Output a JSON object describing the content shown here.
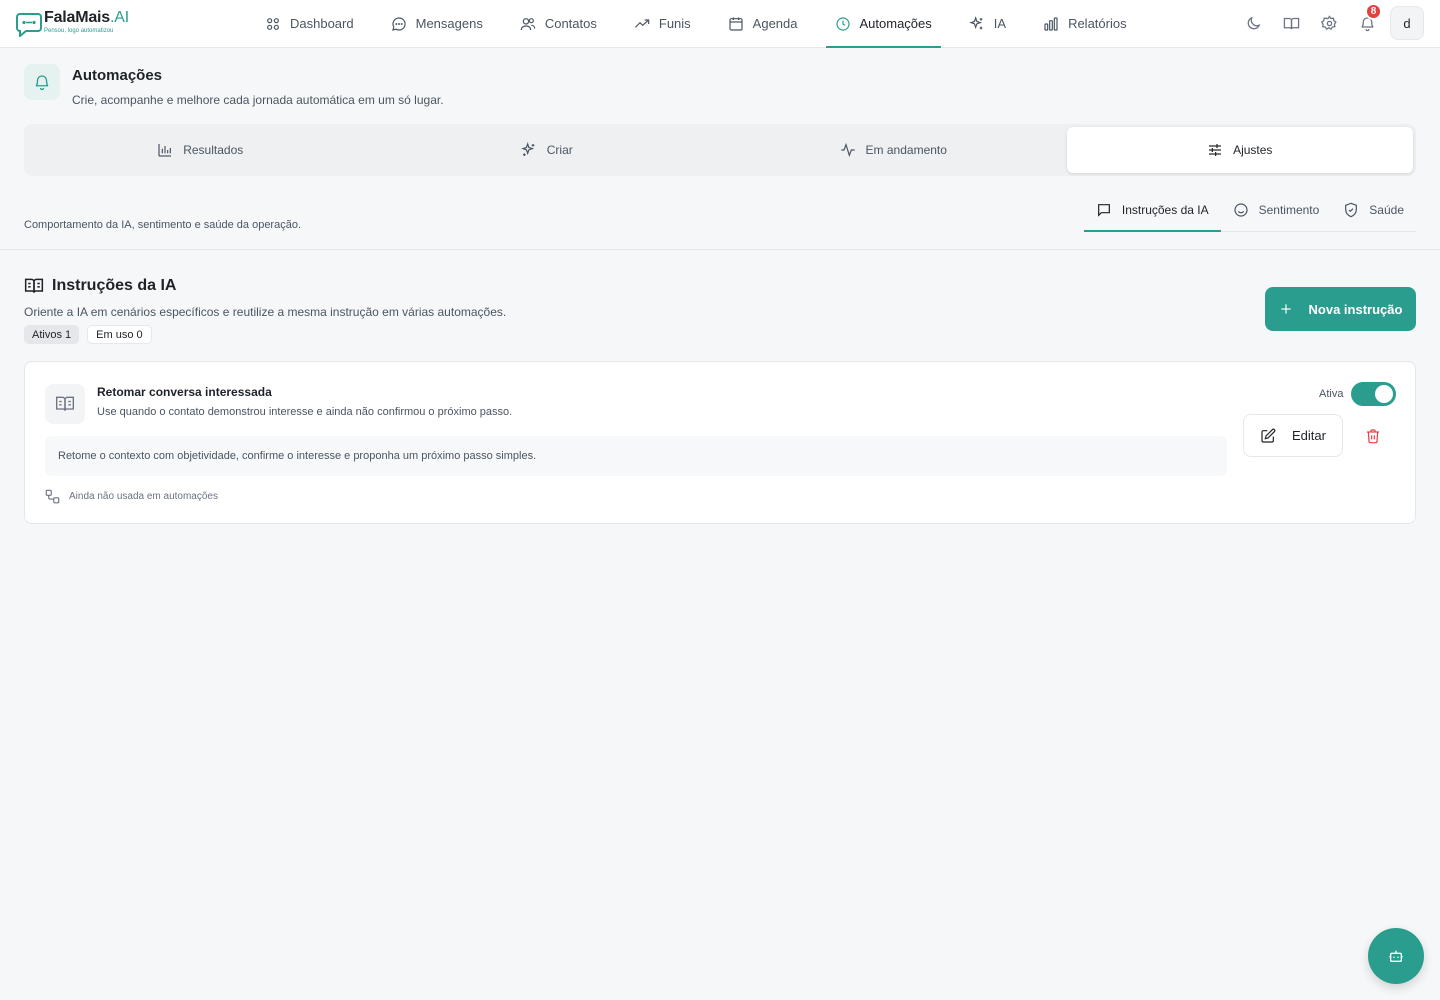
{
  "brand": {
    "name_main": "FalaMais",
    "name_accent": ".AI",
    "tagline": "Pensou, logo automatizou",
    "accent_color": "#2a9d8f"
  },
  "nav": {
    "items": [
      {
        "label": "Dashboard",
        "icon": "grid-icon"
      },
      {
        "label": "Mensagens",
        "icon": "chat-bubble-icon"
      },
      {
        "label": "Contatos",
        "icon": "users-icon"
      },
      {
        "label": "Funis",
        "icon": "trending-up-icon"
      },
      {
        "label": "Agenda",
        "icon": "calendar-icon"
      },
      {
        "label": "Automações",
        "icon": "clock-icon",
        "active": true
      },
      {
        "label": "IA",
        "icon": "sparkles-icon"
      },
      {
        "label": "Relatórios",
        "icon": "bar-chart-icon"
      }
    ]
  },
  "top_actions": {
    "notifications_count": "8",
    "avatar_initial": "d"
  },
  "page": {
    "title": "Automações",
    "subtitle": "Crie, acompanhe e melhore cada jornada automática em um só lugar."
  },
  "segments": [
    {
      "label": "Resultados",
      "icon": "bar-chart-icon"
    },
    {
      "label": "Criar",
      "icon": "sparkles-icon"
    },
    {
      "label": "Em andamento",
      "icon": "activity-icon"
    },
    {
      "label": "Ajustes",
      "icon": "sliders-icon",
      "active": true
    }
  ],
  "settings": {
    "description": "Comportamento da IA, sentimento e saúde da operação.",
    "subtabs": [
      {
        "label": "Instruções da IA",
        "icon": "message-square-icon",
        "active": true
      },
      {
        "label": "Sentimento",
        "icon": "smile-icon"
      },
      {
        "label": "Saúde",
        "icon": "shield-check-icon"
      }
    ]
  },
  "section": {
    "title": "Instruções da IA",
    "subtitle": "Oriente a IA em cenários específicos e reutilize a mesma instrução em várias automações.",
    "chip_active": "Ativos 1",
    "chip_in_use": "Em uso 0",
    "new_button": "Nova instrução"
  },
  "instruction": {
    "title": "Retomar conversa interessada",
    "description": "Use quando o contato demonstrou interesse e ainda não confirmou o próximo passo.",
    "body": "Retome o contexto com objetividade, confirme o interesse e proponha um próximo passo simples.",
    "usage": "Ainda não usada em automações",
    "status_label": "Ativa",
    "enabled": true,
    "edit_label": "Editar"
  }
}
